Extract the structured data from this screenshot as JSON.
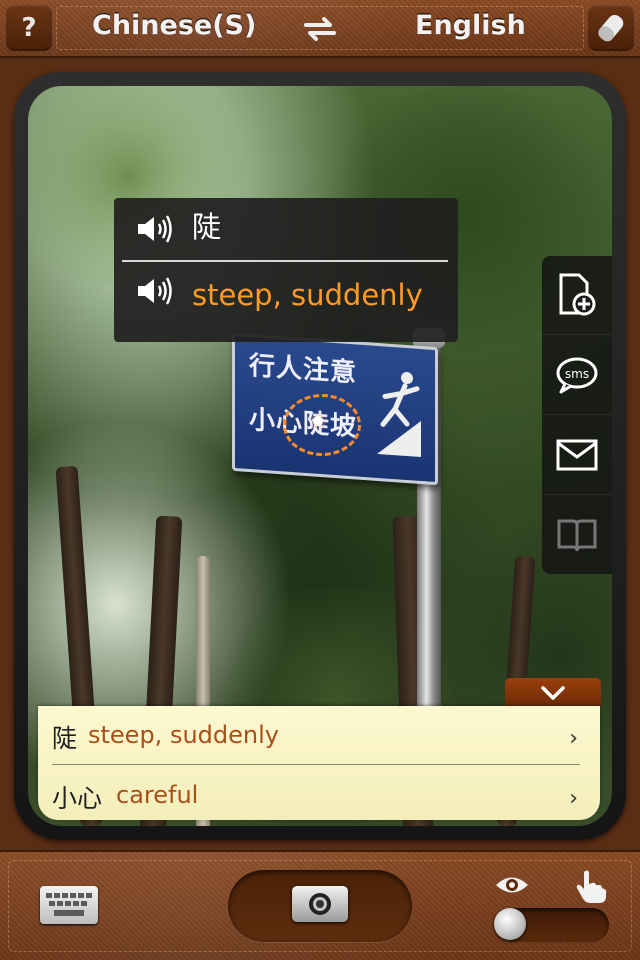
{
  "header": {
    "help_label": "?",
    "source_language": "Chinese(S)",
    "target_language": "English",
    "swap_icon": "swap-arrows-icon",
    "eraser_icon": "eraser-icon"
  },
  "popup": {
    "word": "陡",
    "translation": "steep, suddenly",
    "speaker_icon": "speaker-icon"
  },
  "sign": {
    "line1": "行人注意",
    "line2": "小心陡坡"
  },
  "side_toolbar": {
    "items": [
      {
        "icon": "add-document-icon"
      },
      {
        "icon": "sms-icon",
        "label": "sms"
      },
      {
        "icon": "mail-icon"
      },
      {
        "icon": "book-icon"
      }
    ]
  },
  "results": {
    "collapse_icon": "chevron-down-icon",
    "items": [
      {
        "zh": "陡",
        "en": "steep, suddenly",
        "arrow": "›"
      },
      {
        "zh": "小心",
        "en": "careful",
        "arrow": "›"
      }
    ]
  },
  "footer": {
    "keyboard_icon": "keyboard-icon",
    "camera_icon": "camera-icon",
    "eye_icon": "eye-icon",
    "hand_icon": "hand-pointer-icon"
  },
  "colors": {
    "accent_orange": "#ff9a22",
    "result_text_brown": "#a85018",
    "leather": "#6b3518"
  }
}
